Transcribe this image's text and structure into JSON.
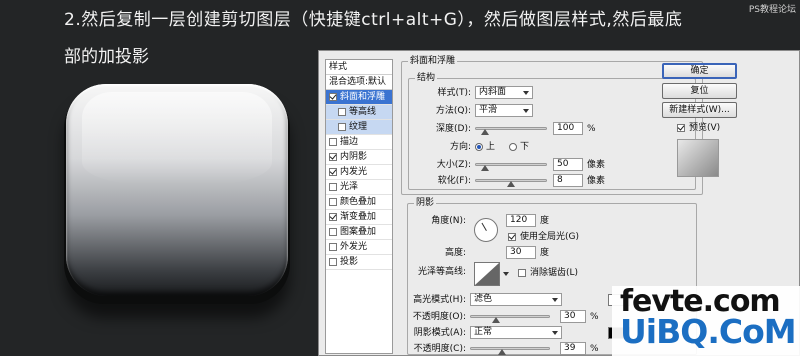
{
  "tutorial": {
    "step_text": "2.然后复制一层创建剪切图层（快捷键ctrl+alt+G），然后做图层样式,然后最底",
    "step_text2": "部的加投影",
    "watermark_top": "PS教程论坛"
  },
  "styles_panel": {
    "header": "样式",
    "blend_options": "混合选项:默认",
    "items": [
      {
        "label": "斜面和浮雕",
        "checked": true,
        "active": true,
        "sub": false
      },
      {
        "label": "等高线",
        "checked": false,
        "active": false,
        "sub": true
      },
      {
        "label": "纹理",
        "checked": false,
        "active": false,
        "sub": true
      },
      {
        "label": "描边",
        "checked": false,
        "active": false,
        "sub": false
      },
      {
        "label": "内阴影",
        "checked": true,
        "active": false,
        "sub": false
      },
      {
        "label": "内发光",
        "checked": true,
        "active": false,
        "sub": false
      },
      {
        "label": "光泽",
        "checked": false,
        "active": false,
        "sub": false
      },
      {
        "label": "颜色叠加",
        "checked": false,
        "active": false,
        "sub": false
      },
      {
        "label": "渐变叠加",
        "checked": true,
        "active": false,
        "sub": false
      },
      {
        "label": "图案叠加",
        "checked": false,
        "active": false,
        "sub": false
      },
      {
        "label": "外发光",
        "checked": false,
        "active": false,
        "sub": false
      },
      {
        "label": "投影",
        "checked": false,
        "active": false,
        "sub": false
      }
    ]
  },
  "bevel": {
    "title": "斜面和浮雕",
    "structure_title": "结构",
    "style_label": "样式(T):",
    "style_value": "内斜面",
    "technique_label": "方法(Q):",
    "technique_value": "平滑",
    "depth_label": "深度(D):",
    "depth_value": "100",
    "depth_unit": "%",
    "direction_label": "方向:",
    "dir_up": "上",
    "dir_down": "下",
    "size_label": "大小(Z):",
    "size_value": "50",
    "size_unit": "像素",
    "soften_label": "软化(F):",
    "soften_value": "8",
    "soften_unit": "像素"
  },
  "shading": {
    "title": "阴影",
    "angle_label": "角度(N):",
    "angle_value": "120",
    "angle_unit": "度",
    "global_light_label": "使用全局光(G)",
    "altitude_label": "高度:",
    "altitude_value": "30",
    "altitude_unit": "度",
    "gloss_contour_label": "光泽等高线:",
    "anti_alias_label": "消除锯齿(L)",
    "highlight_mode_label": "高光模式(H):",
    "highlight_mode_value": "滤色",
    "highlight_opacity_label": "不透明度(O):",
    "highlight_opacity_value": "30",
    "shadow_mode_label": "阴影模式(A):",
    "shadow_mode_value": "正常",
    "shadow_opacity_label": "不透明度(C):",
    "shadow_opacity_value": "39",
    "percent": "%",
    "highlight_color": "#ffffff",
    "shadow_color": "#000000"
  },
  "buttons": {
    "ok": "确定",
    "reset": "复位",
    "new_style": "新建样式(W)...",
    "preview": "预览(V)"
  },
  "watermark": {
    "line1": "fevte.com",
    "line2": "UiBQ.CoM"
  }
}
